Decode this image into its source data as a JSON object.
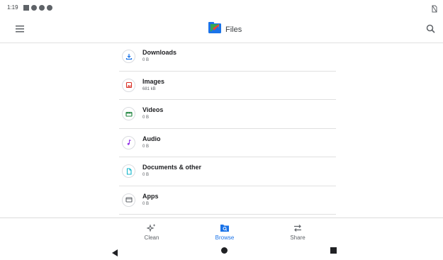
{
  "status_bar": {
    "time": "1:19"
  },
  "app_bar": {
    "title": "Files"
  },
  "categories": [
    {
      "name": "Downloads",
      "size": "0 B",
      "icon": "download-icon",
      "color": "#1a73e8"
    },
    {
      "name": "Images",
      "size": "681 kB",
      "icon": "image-icon",
      "color": "#d93025"
    },
    {
      "name": "Videos",
      "size": "0 B",
      "icon": "video-icon",
      "color": "#188038"
    },
    {
      "name": "Audio",
      "size": "0 B",
      "icon": "music-note-icon",
      "color": "#9334e6"
    },
    {
      "name": "Documents & other",
      "size": "0 B",
      "icon": "document-icon",
      "color": "#12b5cb"
    },
    {
      "name": "Apps",
      "size": "0 B",
      "icon": "apps-icon",
      "color": "#5f6368"
    }
  ],
  "bottom_nav": {
    "items": [
      {
        "label": "Clean",
        "icon": "sparkle-icon"
      },
      {
        "label": "Browse",
        "icon": "browse-folder-icon",
        "active": true
      },
      {
        "label": "Share",
        "icon": "swap-arrows-icon"
      }
    ],
    "accent": "#1a73e8"
  }
}
